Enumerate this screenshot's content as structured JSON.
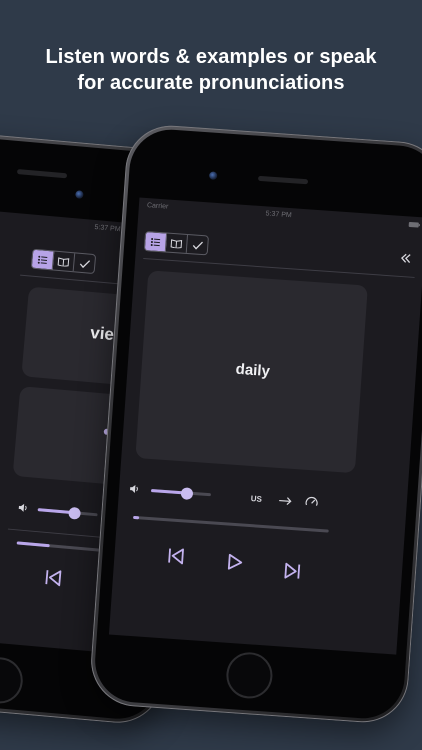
{
  "headline": {
    "line1": "Listen words & examples or speak",
    "line2": "for accurate pronunciations"
  },
  "front_phone": {
    "status": {
      "carrier": "Carrier",
      "time": "5:37 PM"
    },
    "mode_tabs": [
      {
        "name": "list",
        "active": true
      },
      {
        "name": "book",
        "active": false
      },
      {
        "name": "check",
        "active": false
      }
    ],
    "word": "daily",
    "accent": "US",
    "volume_level": 0.6,
    "playback_progress": 0.03
  },
  "back_phone": {
    "status": {
      "time": "5:37 PM"
    },
    "word": "viewer",
    "hidden_dots": 5,
    "volume_level": 0.62,
    "playback_progress": 0.25
  },
  "colors": {
    "accent": "#b7a3e6",
    "background": "#2f3a49",
    "screen": "#1c1b20",
    "card": "#2a292f"
  }
}
